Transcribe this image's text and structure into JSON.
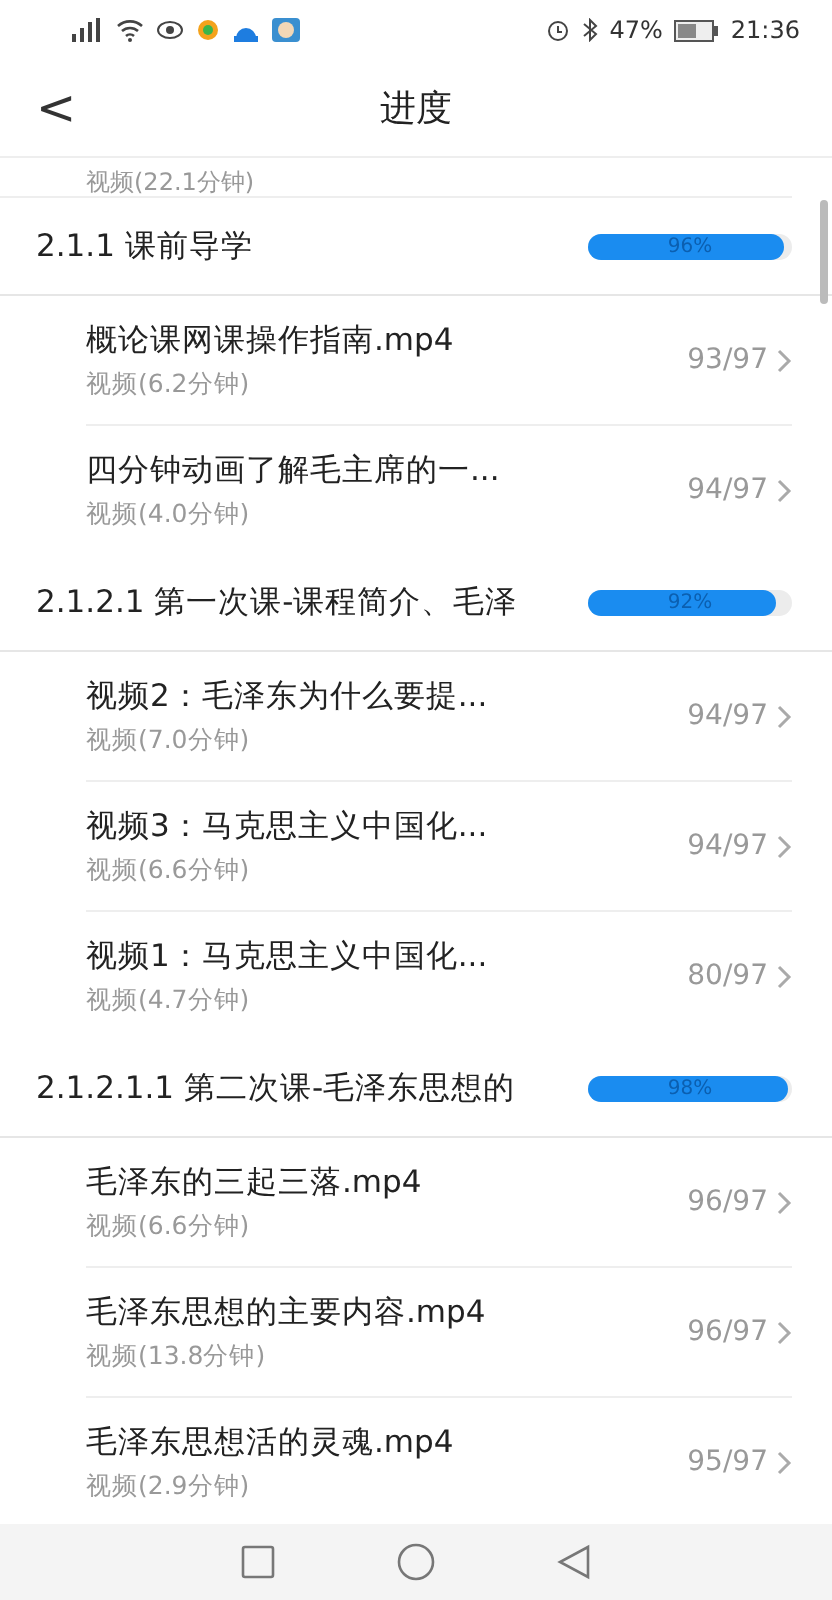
{
  "status_bar": {
    "time": "21:36",
    "battery": "47%"
  },
  "header": {
    "back": "<",
    "title": "进度"
  },
  "partial_item": {
    "subtitle": "视频(22.1分钟)"
  },
  "sections": [
    {
      "title": "2.1.1 课前导学",
      "level": 0.96,
      "percent": "96%",
      "items": [
        {
          "title": "概论课网课操作指南.mp4",
          "subtitle": "视频(6.2分钟)",
          "count": "93/97"
        },
        {
          "title": "四分钟动画了解毛主席的一...",
          "subtitle": "视频(4.0分钟)",
          "count": "94/97"
        }
      ]
    },
    {
      "title": "2.1.2.1 第一次课-课程简介、毛泽",
      "level": 0.92,
      "percent": "92%",
      "items": [
        {
          "title": "视频2：毛泽东为什么要提...",
          "subtitle": "视频(7.0分钟)",
          "count": "94/97"
        },
        {
          "title": "视频3：马克思主义中国化...",
          "subtitle": "视频(6.6分钟)",
          "count": "94/97"
        },
        {
          "title": "视频1：马克思主义中国化...",
          "subtitle": "视频(4.7分钟)",
          "count": "80/97"
        }
      ]
    },
    {
      "title": "2.1.2.1.1 第二次课-毛泽东思想的",
      "level": 0.98,
      "percent": "98%",
      "items": [
        {
          "title": "毛泽东的三起三落.mp4",
          "subtitle": "视频(6.6分钟)",
          "count": "96/97"
        },
        {
          "title": "毛泽东思想的主要内容.mp4",
          "subtitle": "视频(13.8分钟)",
          "count": "96/97"
        },
        {
          "title": "毛泽东思想活的灵魂.mp4",
          "subtitle": "视频(2.9分钟)",
          "count": "95/97"
        }
      ]
    }
  ]
}
